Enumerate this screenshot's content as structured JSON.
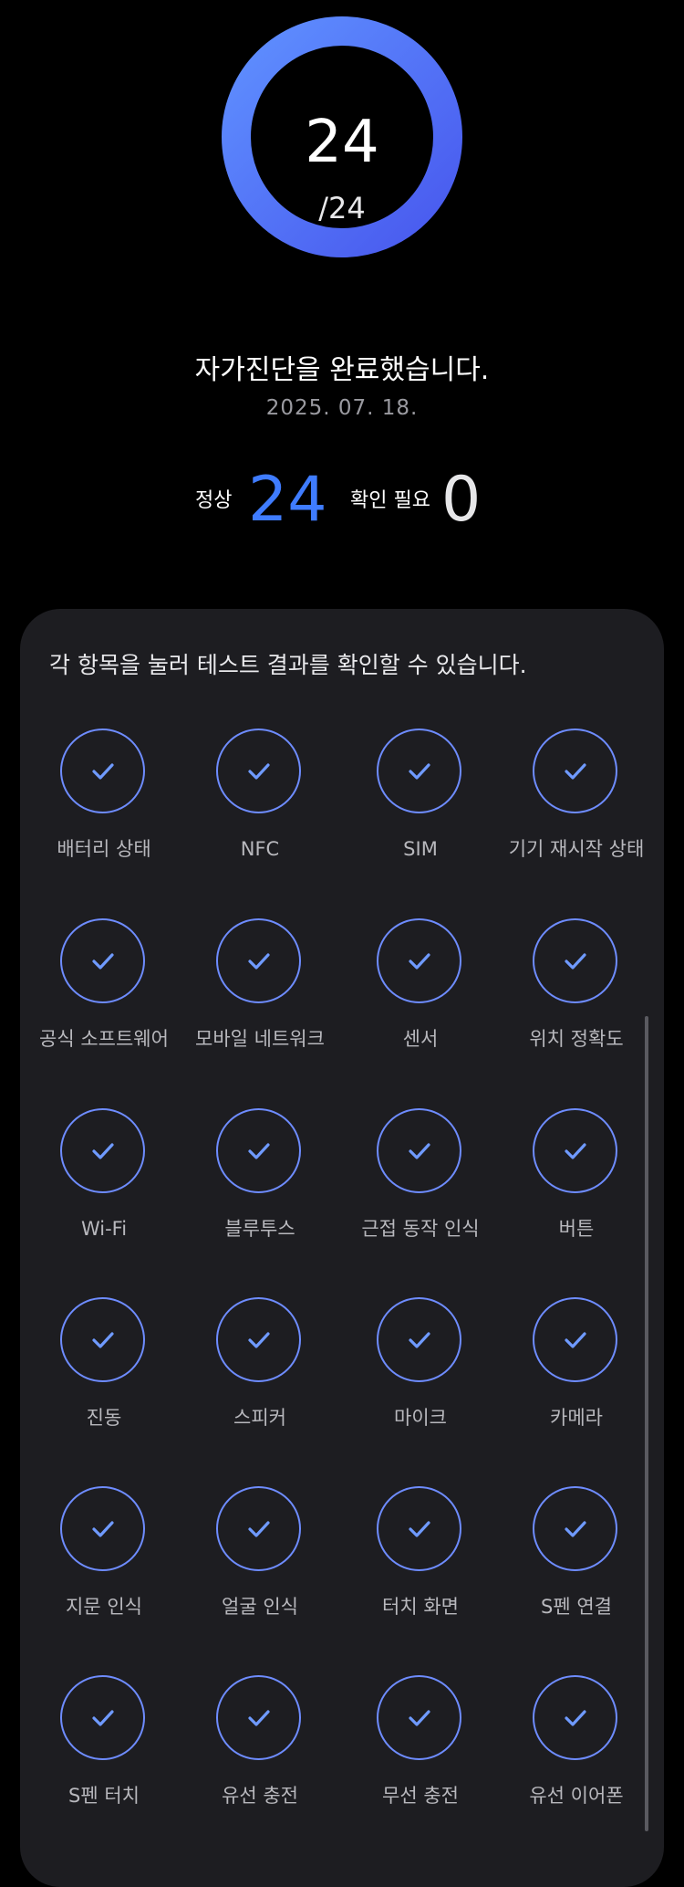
{
  "gauge": {
    "value": "24",
    "total": "/24",
    "progress": 1.0,
    "color_start": "#5b8bff",
    "color_end": "#4a5cf0"
  },
  "result": {
    "message": "자가진단을 완료했습니다.",
    "date": "2025. 07. 18."
  },
  "summary": {
    "normal_label": "정상",
    "normal_value": "24",
    "check_label": "확인 필요",
    "check_value": "0",
    "normal_color": "#3f7cff"
  },
  "panel": {
    "hint": "각 항목을 눌러 테스트 결과를 확인할 수 있습니다."
  },
  "items": [
    {
      "label": "배터리 상태",
      "status": "check-icon"
    },
    {
      "label": "NFC",
      "status": "check-icon"
    },
    {
      "label": "SIM",
      "status": "check-icon"
    },
    {
      "label": "기기 재시작 상태",
      "status": "check-icon"
    },
    {
      "label": "공식 소프트웨어",
      "status": "check-icon"
    },
    {
      "label": "모바일 네트워크",
      "status": "check-icon"
    },
    {
      "label": "센서",
      "status": "check-icon"
    },
    {
      "label": "위치 정확도",
      "status": "check-icon"
    },
    {
      "label": "Wi-Fi",
      "status": "check-icon"
    },
    {
      "label": "블루투스",
      "status": "check-icon"
    },
    {
      "label": "근접 동작 인식",
      "status": "check-icon"
    },
    {
      "label": "버튼",
      "status": "check-icon"
    },
    {
      "label": "진동",
      "status": "check-icon"
    },
    {
      "label": "스피커",
      "status": "check-icon"
    },
    {
      "label": "마이크",
      "status": "check-icon"
    },
    {
      "label": "카메라",
      "status": "check-icon"
    },
    {
      "label": "지문 인식",
      "status": "check-icon"
    },
    {
      "label": "얼굴 인식",
      "status": "check-icon"
    },
    {
      "label": "터치 화면",
      "status": "check-icon"
    },
    {
      "label": "S펜 연결",
      "status": "check-icon"
    },
    {
      "label": "S펜 터치",
      "status": "check-icon"
    },
    {
      "label": "유선 충전",
      "status": "check-icon"
    },
    {
      "label": "무선 충전",
      "status": "check-icon"
    },
    {
      "label": "유선 이어폰",
      "status": "check-icon"
    }
  ]
}
